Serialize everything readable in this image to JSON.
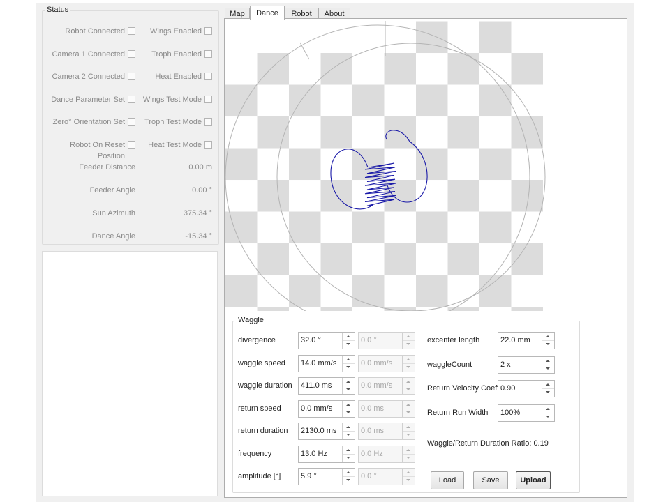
{
  "status": {
    "title": "Status",
    "left_checks": [
      {
        "label": "Robot Connected"
      },
      {
        "label": "Camera 1 Connected"
      },
      {
        "label": "Camera 2 Connected"
      },
      {
        "label": "Dance Parameter Set"
      },
      {
        "label": "Zero° Orientation Set"
      },
      {
        "label": "Robot On Reset Position"
      }
    ],
    "right_checks": [
      {
        "label": "Wings Enabled"
      },
      {
        "label": "Troph Enabled"
      },
      {
        "label": "Heat Enabled"
      },
      {
        "label": "Wings Test Mode"
      },
      {
        "label": "Troph Test Mode"
      },
      {
        "label": "Heat Test Mode"
      }
    ],
    "values": [
      {
        "label": "Feeder Distance",
        "value": "0.00 m"
      },
      {
        "label": "Feeder Angle",
        "value": "0.00 °"
      },
      {
        "label": "Sun Azimuth",
        "value": "375.34 °"
      },
      {
        "label": "Dance Angle",
        "value": "-15.34 °"
      }
    ]
  },
  "tabs": [
    {
      "label": "Map",
      "active": false
    },
    {
      "label": "Dance",
      "active": true
    },
    {
      "label": "Robot",
      "active": false
    },
    {
      "label": "About",
      "active": false
    }
  ],
  "waggle": {
    "title": "Waggle",
    "params": [
      {
        "label": "divergence",
        "value": "32.0 °",
        "secondary": "0.0 °"
      },
      {
        "label": "waggle speed",
        "value": "14.0 mm/s",
        "secondary": "0.0 mm/s"
      },
      {
        "label": "waggle duration",
        "value": "411.0 ms",
        "secondary": "0.0 mm/s"
      },
      {
        "label": "return speed",
        "value": "0.0 mm/s",
        "secondary": "0.0 ms"
      },
      {
        "label": "return duration",
        "value": "2130.0 ms",
        "secondary": "0.0 ms"
      },
      {
        "label": "frequency",
        "value": "13.0 Hz",
        "secondary": "0.0 Hz"
      },
      {
        "label": "amplitude [°]",
        "value": "5.9 °",
        "secondary": "0.0 °"
      }
    ],
    "right_params": [
      {
        "label": "excenter length",
        "value": "22.0 mm"
      },
      {
        "label": "waggleCount",
        "value": "2 x"
      },
      {
        "label": "Return Velocity Coeff.",
        "value": "0.90"
      },
      {
        "label": "Return Run Width",
        "value": "100%"
      }
    ],
    "ratio_text": "Waggle/Return Duration Ratio: 0.19",
    "buttons": {
      "load": "Load",
      "save": "Save",
      "upload": "Upload"
    }
  },
  "colors": {
    "trajectory": "#1a1aa8",
    "checker": "#dcdcdc",
    "guide": "#b4b4b4"
  }
}
